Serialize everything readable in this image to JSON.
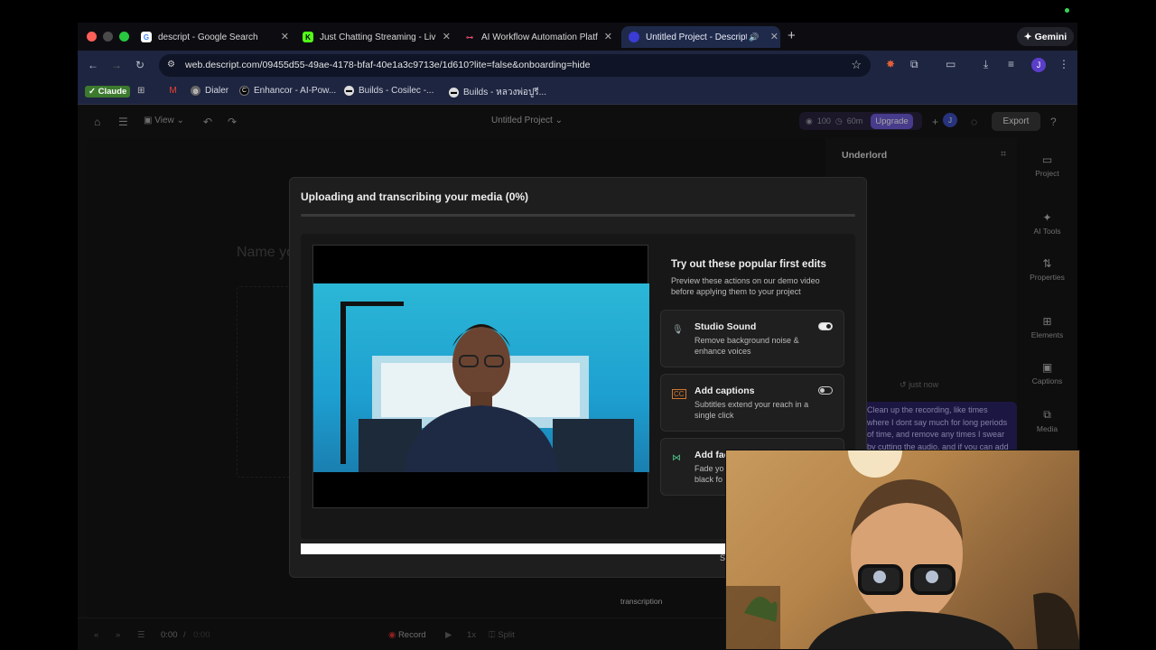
{
  "browser": {
    "tabs": [
      {
        "title": "descript - Google Search",
        "favicon": "google-icon",
        "active": false
      },
      {
        "title": "Just Chatting Streaming - Liv",
        "favicon": "kick-icon",
        "active": false
      },
      {
        "title": "AI Workflow Automation Platf",
        "favicon": "n8n-icon",
        "active": false
      },
      {
        "title": "Untitled Project - Descript",
        "favicon": "descript-icon",
        "active": true
      }
    ],
    "gemini_label": "Gemini",
    "url": "web.descript.com/09455d55-49ae-4178-bfaf-40e1a3c9713e/1d610?lite=false&onboarding=hide",
    "profile_initial": "J",
    "bookmarks": [
      {
        "label": "Claude"
      },
      {
        "label": "Dialer"
      },
      {
        "label": "Enhancor - AI-Pow..."
      },
      {
        "label": "Builds - Cosilec -..."
      },
      {
        "label": "Builds - หลวงพ่อปูรี..."
      }
    ]
  },
  "app": {
    "view_label": "View",
    "project_title": "Untitled Project",
    "credits_a": "100",
    "credits_b": "60m",
    "upgrade_label": "Upgrade",
    "collab_initial": "J",
    "export_label": "Export",
    "name_placeholder": "Name yo",
    "underlord_title": "Underlord",
    "timestamp": "just now",
    "prompt_message": "Clean up the recording, like times where I dont say much for long periods of time, and remove any times I swear by cutting the audio, and if you can add a bleep effect.",
    "transcription_label": "transcription",
    "rail": [
      {
        "label": "Project",
        "icon": "folder-icon"
      },
      {
        "label": "AI Tools",
        "icon": "sparkle-icon"
      },
      {
        "label": "Properties",
        "icon": "sliders-icon"
      },
      {
        "label": "Elements",
        "icon": "shapes-icon"
      },
      {
        "label": "Captions",
        "icon": "captions-icon"
      },
      {
        "label": "Media",
        "icon": "media-icon"
      }
    ],
    "bottom": {
      "time_current": "0:00",
      "time_total": "0:00",
      "record_label": "Record",
      "speed_label": "1x",
      "split_label": "Split"
    }
  },
  "modal": {
    "title": "Uploading and transcribing your media (0%)",
    "progress_percent": 0,
    "try_title": "Try out these popular first edits",
    "try_subtitle": "Preview these actions on our demo video before applying them to your project",
    "cards": [
      {
        "title": "Studio Sound",
        "description": "Remove background noise & enhance voices",
        "enabled": true,
        "icon": "mic-sparkle-icon"
      },
      {
        "title": "Add captions",
        "description": "Subtitles extend your reach in a single click",
        "enabled": false,
        "icon": "captions-icon"
      },
      {
        "title": "Add fac",
        "description": "Fade yo black fo",
        "enabled": false,
        "icon": "fade-icon"
      }
    ],
    "skip_label": "S"
  }
}
